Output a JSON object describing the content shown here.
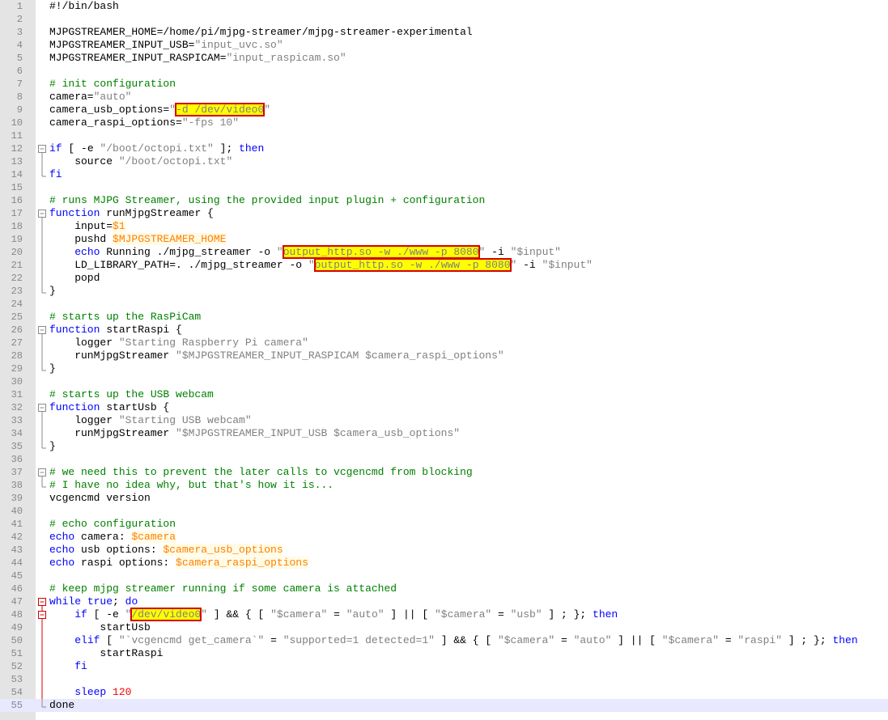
{
  "colors": {
    "gutter_bg": "#e4e4e4",
    "line_number": "#888888",
    "comment": "#008000",
    "keyword": "#0000ff",
    "string": "#808080",
    "variable": "#ff8000",
    "number": "#ff0000",
    "highlight_bg": "#ffff00",
    "highlight_border": "#d60000",
    "current_line": "#e8e8ff",
    "fold_red": "#d00000"
  },
  "current_line": 55,
  "lines": [
    {
      "n": "1",
      "fold": "",
      "tokens": [
        [
          "plain",
          "#!/bin/bash"
        ]
      ]
    },
    {
      "n": "2",
      "fold": "",
      "tokens": []
    },
    {
      "n": "3",
      "fold": "",
      "tokens": [
        [
          "plain",
          "MJPGSTREAMER_HOME=/home/pi/mjpg-streamer/mjpg-streamer-experimental"
        ]
      ]
    },
    {
      "n": "4",
      "fold": "",
      "tokens": [
        [
          "plain",
          "MJPGSTREAMER_INPUT_USB="
        ],
        [
          "string",
          "\"input_uvc.so\""
        ]
      ]
    },
    {
      "n": "5",
      "fold": "",
      "tokens": [
        [
          "plain",
          "MJPGSTREAMER_INPUT_RASPICAM="
        ],
        [
          "string",
          "\"input_raspicam.so\""
        ]
      ]
    },
    {
      "n": "6",
      "fold": "",
      "tokens": []
    },
    {
      "n": "7",
      "fold": "",
      "tokens": [
        [
          "comment",
          "# init configuration"
        ]
      ]
    },
    {
      "n": "8",
      "fold": "",
      "tokens": [
        [
          "plain",
          "camera="
        ],
        [
          "string",
          "\"auto\""
        ]
      ]
    },
    {
      "n": "9",
      "fold": "",
      "tokens": [
        [
          "plain",
          "camera_usb_options="
        ],
        [
          "string",
          "\""
        ],
        [
          "hl",
          "-d /dev/video0"
        ],
        [
          "string",
          "\""
        ]
      ]
    },
    {
      "n": "10",
      "fold": "",
      "tokens": [
        [
          "plain",
          "camera_raspi_options="
        ],
        [
          "string",
          "\"-fps 10\""
        ]
      ]
    },
    {
      "n": "11",
      "fold": "",
      "tokens": []
    },
    {
      "n": "12",
      "fold": "start",
      "tokens": [
        [
          "keyword",
          "if"
        ],
        [
          "plain",
          " [ -e "
        ],
        [
          "string",
          "\"/boot/octopi.txt\""
        ],
        [
          "plain",
          " ]; "
        ],
        [
          "keyword",
          "then"
        ]
      ]
    },
    {
      "n": "13",
      "fold": "mid",
      "tokens": [
        [
          "plain",
          "    source "
        ],
        [
          "string",
          "\"/boot/octopi.txt\""
        ]
      ]
    },
    {
      "n": "14",
      "fold": "end",
      "tokens": [
        [
          "keyword",
          "fi"
        ]
      ]
    },
    {
      "n": "15",
      "fold": "",
      "tokens": []
    },
    {
      "n": "16",
      "fold": "",
      "tokens": [
        [
          "comment",
          "# runs MJPG Streamer, using the provided input plugin + configuration"
        ]
      ]
    },
    {
      "n": "17",
      "fold": "start",
      "tokens": [
        [
          "keyword",
          "function"
        ],
        [
          "plain",
          " runMjpgStreamer {"
        ]
      ]
    },
    {
      "n": "18",
      "fold": "mid",
      "tokens": [
        [
          "plain",
          "    input="
        ],
        [
          "var",
          "$1"
        ]
      ]
    },
    {
      "n": "19",
      "fold": "mid",
      "tokens": [
        [
          "plain",
          "    pushd "
        ],
        [
          "var",
          "$MJPGSTREAMER_HOME"
        ]
      ]
    },
    {
      "n": "20",
      "fold": "mid",
      "tokens": [
        [
          "plain",
          "    "
        ],
        [
          "keyword",
          "echo"
        ],
        [
          "plain",
          " Running ./mjpg_streamer -o "
        ],
        [
          "string",
          "\""
        ],
        [
          "hl",
          "output_http.so -w ./www -p 8080"
        ],
        [
          "string",
          "\""
        ],
        [
          "plain",
          " -i "
        ],
        [
          "string",
          "\"$input\""
        ]
      ]
    },
    {
      "n": "21",
      "fold": "mid",
      "tokens": [
        [
          "plain",
          "    LD_LIBRARY_PATH=. ./mjpg_streamer -o "
        ],
        [
          "string",
          "\""
        ],
        [
          "hl",
          "output_http.so -w ./www -p 8080"
        ],
        [
          "string",
          "\""
        ],
        [
          "plain",
          " -i "
        ],
        [
          "string",
          "\"$input\""
        ]
      ]
    },
    {
      "n": "22",
      "fold": "mid",
      "tokens": [
        [
          "plain",
          "    popd"
        ]
      ]
    },
    {
      "n": "23",
      "fold": "end",
      "tokens": [
        [
          "plain",
          "}"
        ]
      ]
    },
    {
      "n": "24",
      "fold": "",
      "tokens": []
    },
    {
      "n": "25",
      "fold": "",
      "tokens": [
        [
          "comment",
          "# starts up the RasPiCam"
        ]
      ]
    },
    {
      "n": "26",
      "fold": "start",
      "tokens": [
        [
          "keyword",
          "function"
        ],
        [
          "plain",
          " startRaspi {"
        ]
      ]
    },
    {
      "n": "27",
      "fold": "mid",
      "tokens": [
        [
          "plain",
          "    logger "
        ],
        [
          "string",
          "\"Starting Raspberry Pi camera\""
        ]
      ]
    },
    {
      "n": "28",
      "fold": "mid",
      "tokens": [
        [
          "plain",
          "    runMjpgStreamer "
        ],
        [
          "string",
          "\"$MJPGSTREAMER_INPUT_RASPICAM $camera_raspi_options\""
        ]
      ]
    },
    {
      "n": "29",
      "fold": "end",
      "tokens": [
        [
          "plain",
          "}"
        ]
      ]
    },
    {
      "n": "30",
      "fold": "",
      "tokens": []
    },
    {
      "n": "31",
      "fold": "",
      "tokens": [
        [
          "comment",
          "# starts up the USB webcam"
        ]
      ]
    },
    {
      "n": "32",
      "fold": "start",
      "tokens": [
        [
          "keyword",
          "function"
        ],
        [
          "plain",
          " startUsb {"
        ]
      ]
    },
    {
      "n": "33",
      "fold": "mid",
      "tokens": [
        [
          "plain",
          "    logger "
        ],
        [
          "string",
          "\"Starting USB webcam\""
        ]
      ]
    },
    {
      "n": "34",
      "fold": "mid",
      "tokens": [
        [
          "plain",
          "    runMjpgStreamer "
        ],
        [
          "string",
          "\"$MJPGSTREAMER_INPUT_USB $camera_usb_options\""
        ]
      ]
    },
    {
      "n": "35",
      "fold": "end",
      "tokens": [
        [
          "plain",
          "}"
        ]
      ]
    },
    {
      "n": "36",
      "fold": "",
      "tokens": []
    },
    {
      "n": "37",
      "fold": "start",
      "tokens": [
        [
          "comment",
          "# we need this to prevent the later calls to vcgencmd from blocking"
        ]
      ]
    },
    {
      "n": "38",
      "fold": "end",
      "tokens": [
        [
          "comment",
          "# I have no idea why, but that's how it is..."
        ]
      ]
    },
    {
      "n": "39",
      "fold": "",
      "tokens": [
        [
          "plain",
          "vcgencmd version"
        ]
      ]
    },
    {
      "n": "40",
      "fold": "",
      "tokens": []
    },
    {
      "n": "41",
      "fold": "",
      "tokens": [
        [
          "comment",
          "# echo configuration"
        ]
      ]
    },
    {
      "n": "42",
      "fold": "",
      "tokens": [
        [
          "keyword",
          "echo"
        ],
        [
          "plain",
          " camera: "
        ],
        [
          "var",
          "$camera"
        ]
      ]
    },
    {
      "n": "43",
      "fold": "",
      "tokens": [
        [
          "keyword",
          "echo"
        ],
        [
          "plain",
          " usb options: "
        ],
        [
          "var",
          "$camera_usb_options"
        ]
      ]
    },
    {
      "n": "44",
      "fold": "",
      "tokens": [
        [
          "keyword",
          "echo"
        ],
        [
          "plain",
          " raspi options: "
        ],
        [
          "var",
          "$camera_raspi_options"
        ]
      ]
    },
    {
      "n": "45",
      "fold": "",
      "tokens": []
    },
    {
      "n": "46",
      "fold": "",
      "tokens": [
        [
          "comment",
          "# keep mjpg streamer running if some camera is attached"
        ]
      ]
    },
    {
      "n": "47",
      "fold": "start-red",
      "tokens": [
        [
          "keyword",
          "while"
        ],
        [
          "plain",
          " "
        ],
        [
          "keyword",
          "true"
        ],
        [
          "plain",
          "; "
        ],
        [
          "keyword",
          "do"
        ]
      ]
    },
    {
      "n": "48",
      "fold": "start-inner",
      "tokens": [
        [
          "plain",
          "    "
        ],
        [
          "keyword",
          "if"
        ],
        [
          "plain",
          " [ -e "
        ],
        [
          "string",
          "\""
        ],
        [
          "hl",
          "/dev/video0"
        ],
        [
          "string",
          "\""
        ],
        [
          "plain",
          " ] && { [ "
        ],
        [
          "string",
          "\"$camera\""
        ],
        [
          "plain",
          " = "
        ],
        [
          "string",
          "\"auto\""
        ],
        [
          "plain",
          " ] || [ "
        ],
        [
          "string",
          "\"$camera\""
        ],
        [
          "plain",
          " = "
        ],
        [
          "string",
          "\"usb\""
        ],
        [
          "plain",
          " ] ; }; "
        ],
        [
          "keyword",
          "then"
        ]
      ]
    },
    {
      "n": "49",
      "fold": "mid-red",
      "tokens": [
        [
          "plain",
          "        startUsb"
        ]
      ]
    },
    {
      "n": "50",
      "fold": "mid-red",
      "tokens": [
        [
          "plain",
          "    "
        ],
        [
          "keyword",
          "elif"
        ],
        [
          "plain",
          " [ "
        ],
        [
          "string",
          "\"`vcgencmd get_camera`\""
        ],
        [
          "plain",
          " = "
        ],
        [
          "string",
          "\"supported=1 detected=1\""
        ],
        [
          "plain",
          " ] && { [ "
        ],
        [
          "string",
          "\"$camera\""
        ],
        [
          "plain",
          " = "
        ],
        [
          "string",
          "\"auto\""
        ],
        [
          "plain",
          " ] || [ "
        ],
        [
          "string",
          "\"$camera\""
        ],
        [
          "plain",
          " = "
        ],
        [
          "string",
          "\"raspi\""
        ],
        [
          "plain",
          " ] ; }; "
        ],
        [
          "keyword",
          "then"
        ]
      ]
    },
    {
      "n": "51",
      "fold": "mid-red",
      "tokens": [
        [
          "plain",
          "        startRaspi"
        ]
      ]
    },
    {
      "n": "52",
      "fold": "mid-red",
      "tokens": [
        [
          "plain",
          "    "
        ],
        [
          "keyword",
          "fi"
        ]
      ]
    },
    {
      "n": "53",
      "fold": "mid-red",
      "tokens": []
    },
    {
      "n": "54",
      "fold": "mid-red",
      "tokens": [
        [
          "plain",
          "    "
        ],
        [
          "keyword",
          "sleep"
        ],
        [
          "plain",
          " "
        ],
        [
          "number",
          "120"
        ]
      ]
    },
    {
      "n": "55",
      "fold": "end",
      "tokens": [
        [
          "plain",
          "done"
        ]
      ]
    }
  ]
}
